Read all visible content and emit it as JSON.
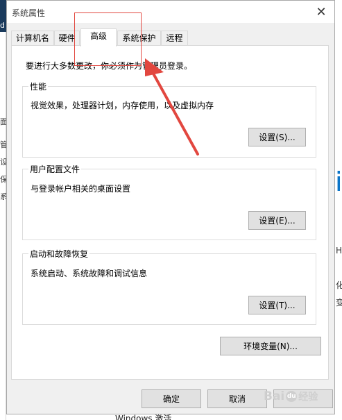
{
  "dialog": {
    "title": "系统属性",
    "close_glyph": "✕"
  },
  "tabs": [
    {
      "label": "计算机名",
      "active": false
    },
    {
      "label": "硬件",
      "active": false
    },
    {
      "label": "高级",
      "active": true
    },
    {
      "label": "系统保护",
      "active": false
    },
    {
      "label": "远程",
      "active": false
    }
  ],
  "panel": {
    "admin_note": "要进行大多数更改，你必须作为管理员登录。",
    "performance": {
      "title": "性能",
      "description": "视觉效果，处理器计划，内存使用，以及虚拟内存",
      "button": "设置(S)..."
    },
    "user_profiles": {
      "title": "用户配置文件",
      "description": "与登录帐户相关的桌面设置",
      "button": "设置(E)..."
    },
    "startup_recovery": {
      "title": "启动和故障恢复",
      "description": "系统启动、系统故障和调试信息",
      "button": "设置(T)..."
    },
    "env_button": "环境变量(N)..."
  },
  "footer": {
    "ok": "确定",
    "cancel": "取消"
  },
  "background": {
    "left_chars": [
      "d",
      "面",
      "管",
      "设",
      "保",
      "系"
    ],
    "right_chars": [
      "H",
      "化",
      "变"
    ],
    "right_big": "i",
    "bottom_text": "Windows 激活"
  },
  "watermark": {
    "brand": "Bai",
    "paw": "du",
    "suffix": "经验"
  },
  "colors": {
    "annotation": "#e2473f",
    "dialog_bg": "#f0f0f0",
    "panel_bg": "#ffffff",
    "button_bg": "#e1e1e1"
  }
}
